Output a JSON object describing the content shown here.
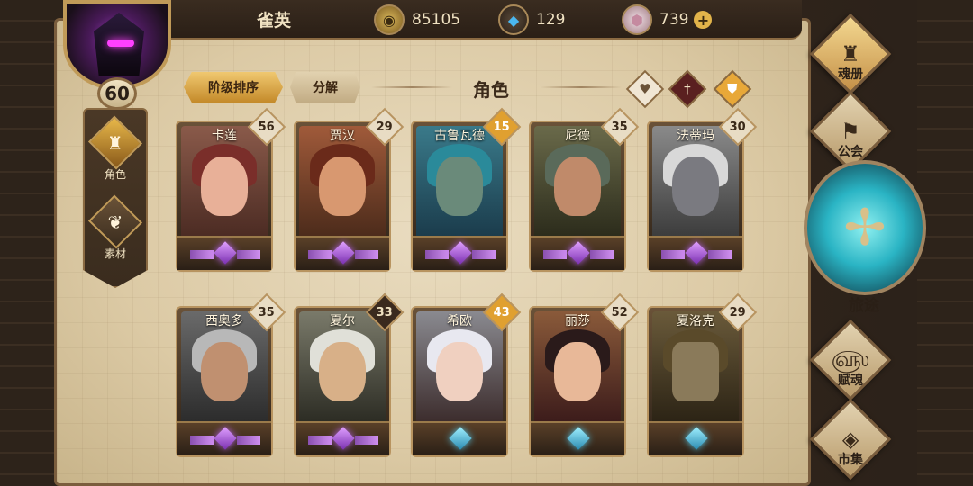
{
  "player": {
    "name": "雀英",
    "level": "60"
  },
  "currencies": [
    {
      "icon": "gold-coin-icon",
      "value": "85105"
    },
    {
      "icon": "blue-crystal-icon",
      "value": "129"
    },
    {
      "icon": "pink-gem-icon",
      "value": "739"
    }
  ],
  "left_nav": [
    {
      "label": "角色",
      "active": true
    },
    {
      "label": "素材",
      "active": false
    }
  ],
  "tabs": {
    "sort": "阶级排序",
    "decompose": "分解"
  },
  "section_title": "角色",
  "filters": [
    "heart-filter-icon",
    "sword-filter-icon",
    "shield-filter-icon"
  ],
  "characters": [
    {
      "name": "卡莲",
      "level": "56",
      "tag": "normal",
      "gem": "purple"
    },
    {
      "name": "贾汉",
      "level": "29",
      "tag": "normal",
      "gem": "purple"
    },
    {
      "name": "古鲁瓦德",
      "level": "15",
      "tag": "gold",
      "gem": "purple"
    },
    {
      "name": "尼德",
      "level": "35",
      "tag": "normal",
      "gem": "purple"
    },
    {
      "name": "法蒂玛",
      "level": "30",
      "tag": "normal",
      "gem": "purple"
    },
    {
      "name": "西奥多",
      "level": "35",
      "tag": "normal",
      "gem": "purple"
    },
    {
      "name": "夏尔",
      "level": "33",
      "tag": "dark",
      "gem": "purple"
    },
    {
      "name": "希欧",
      "level": "43",
      "tag": "gold",
      "gem": "blue"
    },
    {
      "name": "丽莎",
      "level": "52",
      "tag": "normal",
      "gem": "blue"
    },
    {
      "name": "夏洛克",
      "level": "29",
      "tag": "normal",
      "gem": "blue"
    }
  ],
  "right_nav": {
    "soul_book": "魂册",
    "guild": "公会",
    "journey": "旅途",
    "soul_gift": "赋魂",
    "market": "市集"
  },
  "colors": {
    "accent_gold": "#e0a030",
    "parchment": "#e9dcc0",
    "frame": "#2d231a",
    "journey_cyan": "#2ab4c4"
  }
}
